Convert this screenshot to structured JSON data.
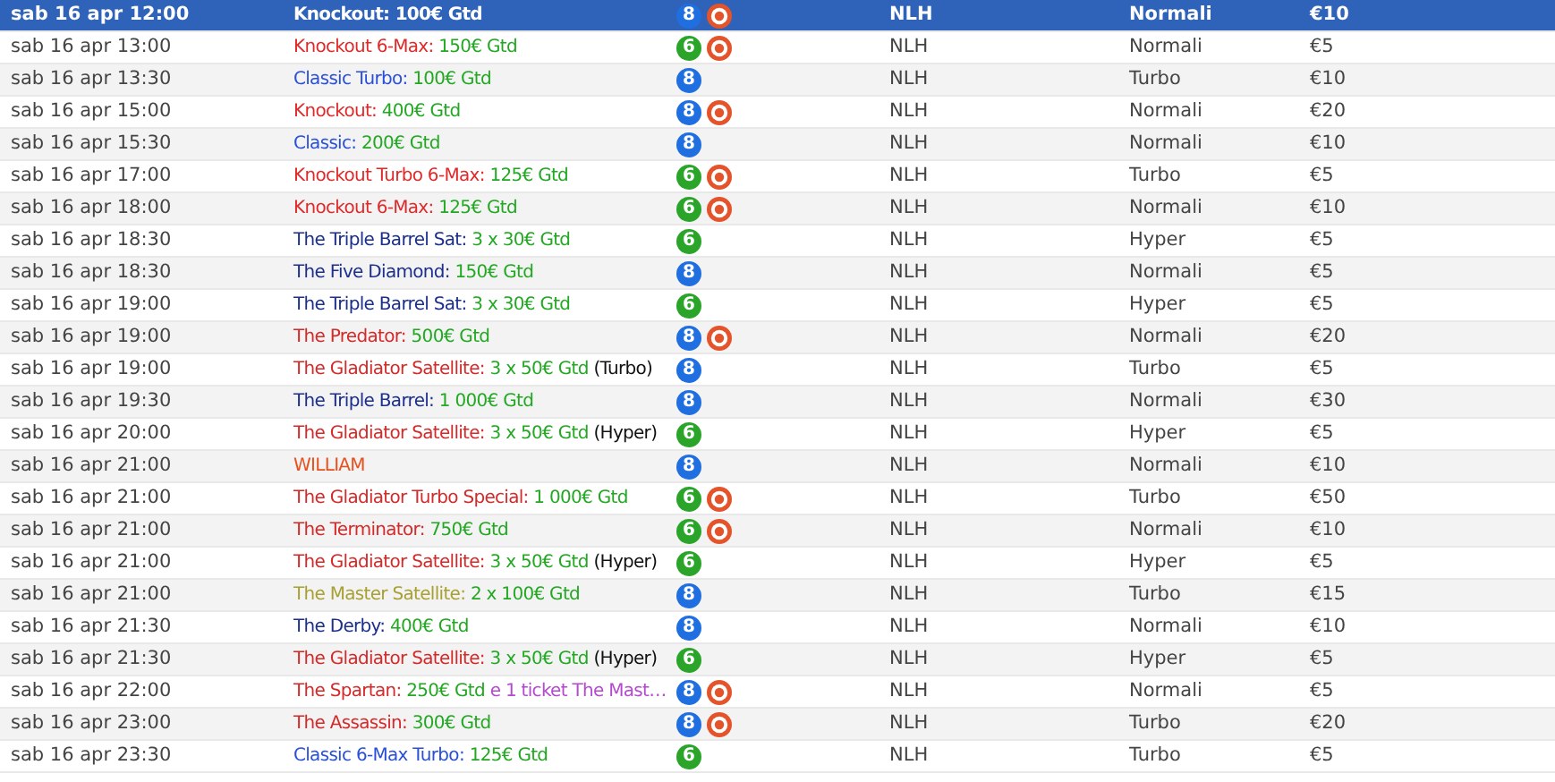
{
  "rows": [
    {
      "date": "sab 16 apr 12:00",
      "name": "Knockout:",
      "prize": "100€ Gtd",
      "seats": {
        "text": "8",
        "color": "#1f6fe0"
      },
      "knockout": true,
      "game": "NLH",
      "speed": "Normali",
      "buyin": "€10",
      "selected": true
    },
    {
      "date": "sab 16 apr 13:00",
      "name": "Knockout 6-Max:",
      "color": "#e02a2a",
      "prize": "150€ Gtd",
      "seats": {
        "text": "6",
        "color": "#2aa52a"
      },
      "knockout": true,
      "game": "NLH",
      "speed": "Normali",
      "buyin": "€5",
      "selected": false
    },
    {
      "date": "sab 16 apr 13:30",
      "name": "Classic Turbo:",
      "color": "#2a4fd8",
      "prize": "100€ Gtd",
      "seats": {
        "text": "8",
        "color": "#1f6fe0"
      },
      "knockout": false,
      "game": "NLH",
      "speed": "Turbo",
      "buyin": "€10",
      "selected": false
    },
    {
      "date": "sab 16 apr 15:00",
      "name": "Knockout:",
      "color": "#e02a2a",
      "prize": "400€ Gtd",
      "seats": {
        "text": "8",
        "color": "#1f6fe0"
      },
      "knockout": true,
      "game": "NLH",
      "speed": "Normali",
      "buyin": "€20",
      "selected": false
    },
    {
      "date": "sab 16 apr 15:30",
      "name": "Classic:",
      "color": "#2a4fd8",
      "prize": "200€ Gtd",
      "seats": {
        "text": "8",
        "color": "#1f6fe0"
      },
      "knockout": false,
      "game": "NLH",
      "speed": "Normali",
      "buyin": "€10",
      "selected": false
    },
    {
      "date": "sab 16 apr 17:00",
      "name": "Knockout Turbo 6-Max:",
      "color": "#e02a2a",
      "prize": "125€ Gtd",
      "seats": {
        "text": "6",
        "color": "#2aa52a"
      },
      "knockout": true,
      "game": "NLH",
      "speed": "Turbo",
      "buyin": "€5",
      "selected": false
    },
    {
      "date": "sab 16 apr 18:00",
      "name": "Knockout 6-Max:",
      "color": "#e02a2a",
      "prize": "125€ Gtd",
      "seats": {
        "text": "6",
        "color": "#2aa52a"
      },
      "knockout": true,
      "game": "NLH",
      "speed": "Normali",
      "buyin": "€10",
      "selected": false
    },
    {
      "date": "sab 16 apr 18:30",
      "name": "The Triple Barrel Sat:",
      "color": "#1c2f8c",
      "prize": "3 x 30€ Gtd",
      "seats": {
        "text": "6",
        "color": "#2aa52a"
      },
      "knockout": false,
      "game": "NLH",
      "speed": "Hyper",
      "buyin": "€5",
      "selected": false
    },
    {
      "date": "sab 16 apr 18:30",
      "name": "The Five Diamond:",
      "color": "#1c2f8c",
      "prize": "150€ Gtd",
      "seats": {
        "text": "8",
        "color": "#1f6fe0"
      },
      "knockout": false,
      "game": "NLH",
      "speed": "Normali",
      "buyin": "€5",
      "selected": false
    },
    {
      "date": "sab 16 apr 19:00",
      "name": "The Triple Barrel Sat:",
      "color": "#1c2f8c",
      "prize": "3 x 30€ Gtd",
      "seats": {
        "text": "6",
        "color": "#2aa52a"
      },
      "knockout": false,
      "game": "NLH",
      "speed": "Hyper",
      "buyin": "€5",
      "selected": false
    },
    {
      "date": "sab 16 apr 19:00",
      "name": "The Predator:",
      "color": "#d42a2a",
      "prize": "500€ Gtd",
      "seats": {
        "text": "8",
        "color": "#1f6fe0"
      },
      "knockout": true,
      "game": "NLH",
      "speed": "Normali",
      "buyin": "€20",
      "selected": false
    },
    {
      "date": "sab 16 apr 19:00",
      "name": "The Gladiator Satellite:",
      "color": "#d42a2a",
      "prize": "3 x 50€ Gtd",
      "note": "(Turbo)",
      "seats": {
        "text": "8",
        "color": "#1f6fe0"
      },
      "knockout": false,
      "game": "NLH",
      "speed": "Turbo",
      "buyin": "€5",
      "selected": false
    },
    {
      "date": "sab 16 apr 19:30",
      "name": "The Triple Barrel:",
      "color": "#1c2f8c",
      "prize": "1 000€ Gtd",
      "seats": {
        "text": "8",
        "color": "#1f6fe0"
      },
      "knockout": false,
      "game": "NLH",
      "speed": "Normali",
      "buyin": "€30",
      "selected": false
    },
    {
      "date": "sab 16 apr 20:00",
      "name": "The Gladiator Satellite:",
      "color": "#d42a2a",
      "prize": "3 x 50€ Gtd",
      "note": "(Hyper)",
      "seats": {
        "text": "6",
        "color": "#2aa52a"
      },
      "knockout": false,
      "game": "NLH",
      "speed": "Hyper",
      "buyin": "€5",
      "selected": false
    },
    {
      "date": "sab 16 apr 21:00",
      "name": "WILLIAM",
      "color": "#e8501e",
      "seats": {
        "text": "8",
        "color": "#1f6fe0"
      },
      "knockout": false,
      "game": "NLH",
      "speed": "Normali",
      "buyin": "€10",
      "selected": false
    },
    {
      "date": "sab 16 apr 21:00",
      "name": "The Gladiator Turbo Special:",
      "color": "#d42a2a",
      "prize": "1 000€ Gtd",
      "seats": {
        "text": "6",
        "color": "#2aa52a"
      },
      "knockout": true,
      "game": "NLH",
      "speed": "Turbo",
      "buyin": "€50",
      "selected": false
    },
    {
      "date": "sab 16 apr 21:00",
      "name": "The Terminator:",
      "color": "#d42a2a",
      "prize": "750€ Gtd",
      "seats": {
        "text": "6",
        "color": "#2aa52a"
      },
      "knockout": true,
      "game": "NLH",
      "speed": "Normali",
      "buyin": "€10",
      "selected": false
    },
    {
      "date": "sab 16 apr 21:00",
      "name": "The Gladiator Satellite:",
      "color": "#d42a2a",
      "prize": "3 x 50€ Gtd",
      "note": "(Hyper)",
      "seats": {
        "text": "6",
        "color": "#2aa52a"
      },
      "knockout": false,
      "game": "NLH",
      "speed": "Hyper",
      "buyin": "€5",
      "selected": false
    },
    {
      "date": "sab 16 apr 21:00",
      "name": "The Master Satellite:",
      "color": "#a8a032",
      "prize": "2 x 100€ Gtd",
      "seats": {
        "text": "8",
        "color": "#1f6fe0"
      },
      "knockout": false,
      "game": "NLH",
      "speed": "Turbo",
      "buyin": "€15",
      "selected": false
    },
    {
      "date": "sab 16 apr 21:30",
      "name": "The Derby:",
      "color": "#1c2f8c",
      "prize": "400€ Gtd",
      "seats": {
        "text": "8",
        "color": "#1f6fe0"
      },
      "knockout": false,
      "game": "NLH",
      "speed": "Normali",
      "buyin": "€10",
      "selected": false
    },
    {
      "date": "sab 16 apr 21:30",
      "name": "The Gladiator Satellite:",
      "color": "#d42a2a",
      "prize": "3 x 50€ Gtd",
      "note": "(Hyper)",
      "seats": {
        "text": "6",
        "color": "#2aa52a"
      },
      "knockout": false,
      "game": "NLH",
      "speed": "Hyper",
      "buyin": "€5",
      "selected": false
    },
    {
      "date": "sab 16 apr 22:00",
      "name": "The Spartan:",
      "color": "#d42a2a",
      "prize": "250€ Gtd",
      "bonus": "e 1 ticket The Mast…",
      "seats": {
        "text": "8",
        "color": "#1f6fe0"
      },
      "knockout": true,
      "game": "NLH",
      "speed": "Normali",
      "buyin": "€5",
      "selected": false
    },
    {
      "date": "sab 16 apr 23:00",
      "name": "The Assassin:",
      "color": "#d42a2a",
      "prize": "300€ Gtd",
      "seats": {
        "text": "8",
        "color": "#1f6fe0"
      },
      "knockout": true,
      "game": "NLH",
      "speed": "Turbo",
      "buyin": "€20",
      "selected": false
    },
    {
      "date": "sab 16 apr 23:30",
      "name": "Classic 6-Max Turbo:",
      "color": "#2a4fd8",
      "prize": "125€ Gtd",
      "seats": {
        "text": "6",
        "color": "#2aa52a"
      },
      "knockout": false,
      "game": "NLH",
      "speed": "Turbo",
      "buyin": "€5",
      "selected": false
    }
  ]
}
